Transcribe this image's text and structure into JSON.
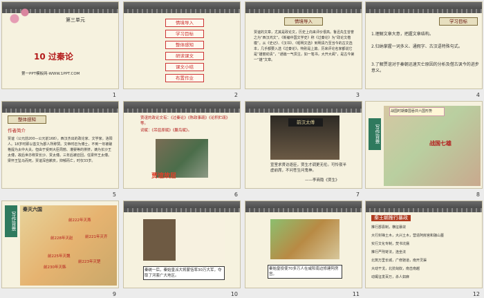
{
  "slide1": {
    "unit": "第三单元",
    "title": "10  过秦论",
    "subtitle": "第一PPT模板网-WWW.1PPT.COM",
    "number": "1"
  },
  "slide2": {
    "menu": [
      "情境导入",
      "学习目标",
      "整体感知",
      "研读课文",
      "课文小结",
      "布置作业"
    ],
    "number": "2"
  },
  "slide3": {
    "header": "情境导入",
    "text": "贾谊的文章，尤其是政论文，历史上向来评价很高。鲁迅先生曾誉之为“西汉鸿文”。《新编中国文学史》称《过秦论》为“政论文楷模”。从《史记》、《汉书》、《昭明文选》到明清乃至当今的古文选本，几乎都要入选《过秦论》，特别是上篇。历来评论名家都说它是“雄丽劲清”，“通篇一气贯注，如一笔书，大开大阖”，是古今第一“雄”文章。",
    "number": "3"
  },
  "slide4": {
    "header": "学习目标",
    "items": [
      "1.理解文章大意，把握文章结构。",
      "2.归纳掌握一词多义、通假字、古汉语特殊句式。",
      "3.了解贾谊对于秦朝迅速灭亡原因的分析及借古讽今的进步意义。"
    ],
    "number": "4"
  },
  "slide5": {
    "header": "整体感知",
    "label": "作者简介",
    "text": "贾谊（公元前200—公元前168），西汉杰出的政论家、文学家。洛阳人。18岁时即以善文为郡人所称赞。文帝时召为博士，不到一年被破格提为太中大夫。但由于受到大臣周勃、灌婴等的排挤，谪为长沙王太傅，故后世亦称贾长沙、贾太傅。三年后被召回，任梁怀王太傅。梁怀王坠马而死，贾谊深自歉疚，抑郁而亡，时仅33岁。",
    "number": "5"
  },
  "slide6": {
    "text1": "贾谊的政论文有：《过秦论》《陈政事疏》《论积贮疏》等。",
    "text2": "词赋：《吊屈原赋》《鵩鸟赋》。",
    "caption": "贾谊故居",
    "number": "6"
  },
  "slide7": {
    "sign": "前汉太傅",
    "poem": "宣室求贤访逐臣，贾生才调更无伦。可怜夜半虚前席，不问苍生问鬼神。",
    "author": "——李商隐《贾生》",
    "number": "7"
  },
  "slide8": {
    "side": "写作背景",
    "map_title": "战国七雄",
    "note": "战国时期秦国吞并六国形势",
    "number": "8"
  },
  "slide9": {
    "side": "写作背景",
    "map_title": "秦灭六国",
    "labels": [
      "前230年灭韩",
      "前228年灭赵",
      "前225年灭魏",
      "前223年灭楚",
      "前222年灭燕",
      "前221年灭齐"
    ],
    "number": "9"
  },
  "slide10": {
    "caption": "秦统一后，秦始皇派大将蒙恬率30万大军，夺取了河套广大地区。",
    "number": "10"
  },
  "slide11": {
    "caption": "秦始皇役使70多万人在咸阳南边修建阿房宫。",
    "number": "11"
  },
  "slide12": {
    "header": "秦王朝推行暴政",
    "items": [
      "推行郡县制，横征暴敛",
      "大行封禅土木，大兴土木，营造阿房宫和骊山墓",
      "实行文化专制，焚书坑儒",
      "推行严刑苛法，连坐法",
      "北筑万里长城，广修驰道，南开灵渠",
      "大动干戈，北抗匈奴，南击南越",
      "动辄征发百万，杀人如麻"
    ],
    "number": "12"
  }
}
